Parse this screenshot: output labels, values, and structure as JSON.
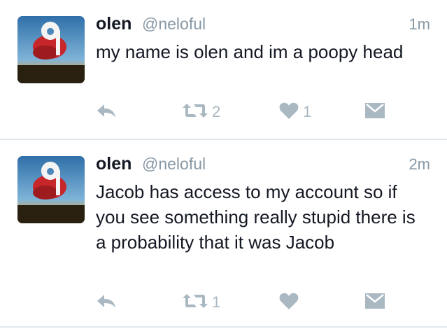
{
  "tweets": [
    {
      "name": "olen",
      "handle": "@neloful",
      "time": "1m",
      "text": "my name is olen and im a poopy head",
      "retweets": "2",
      "likes": "1"
    },
    {
      "name": "olen",
      "handle": "@neloful",
      "time": "2m",
      "text": "Jacob has access to my account so if you see something really stupid there is a probability that it was Jacob",
      "retweets": "1",
      "likes": ""
    }
  ],
  "icons": {
    "reply": "reply-icon",
    "retweet": "retweet-icon",
    "like": "heart-icon",
    "dm": "direct-message-icon"
  },
  "colors": {
    "icon": "#aab8c2",
    "secondary_text": "#8899a6",
    "divider": "#e1e8ed"
  }
}
